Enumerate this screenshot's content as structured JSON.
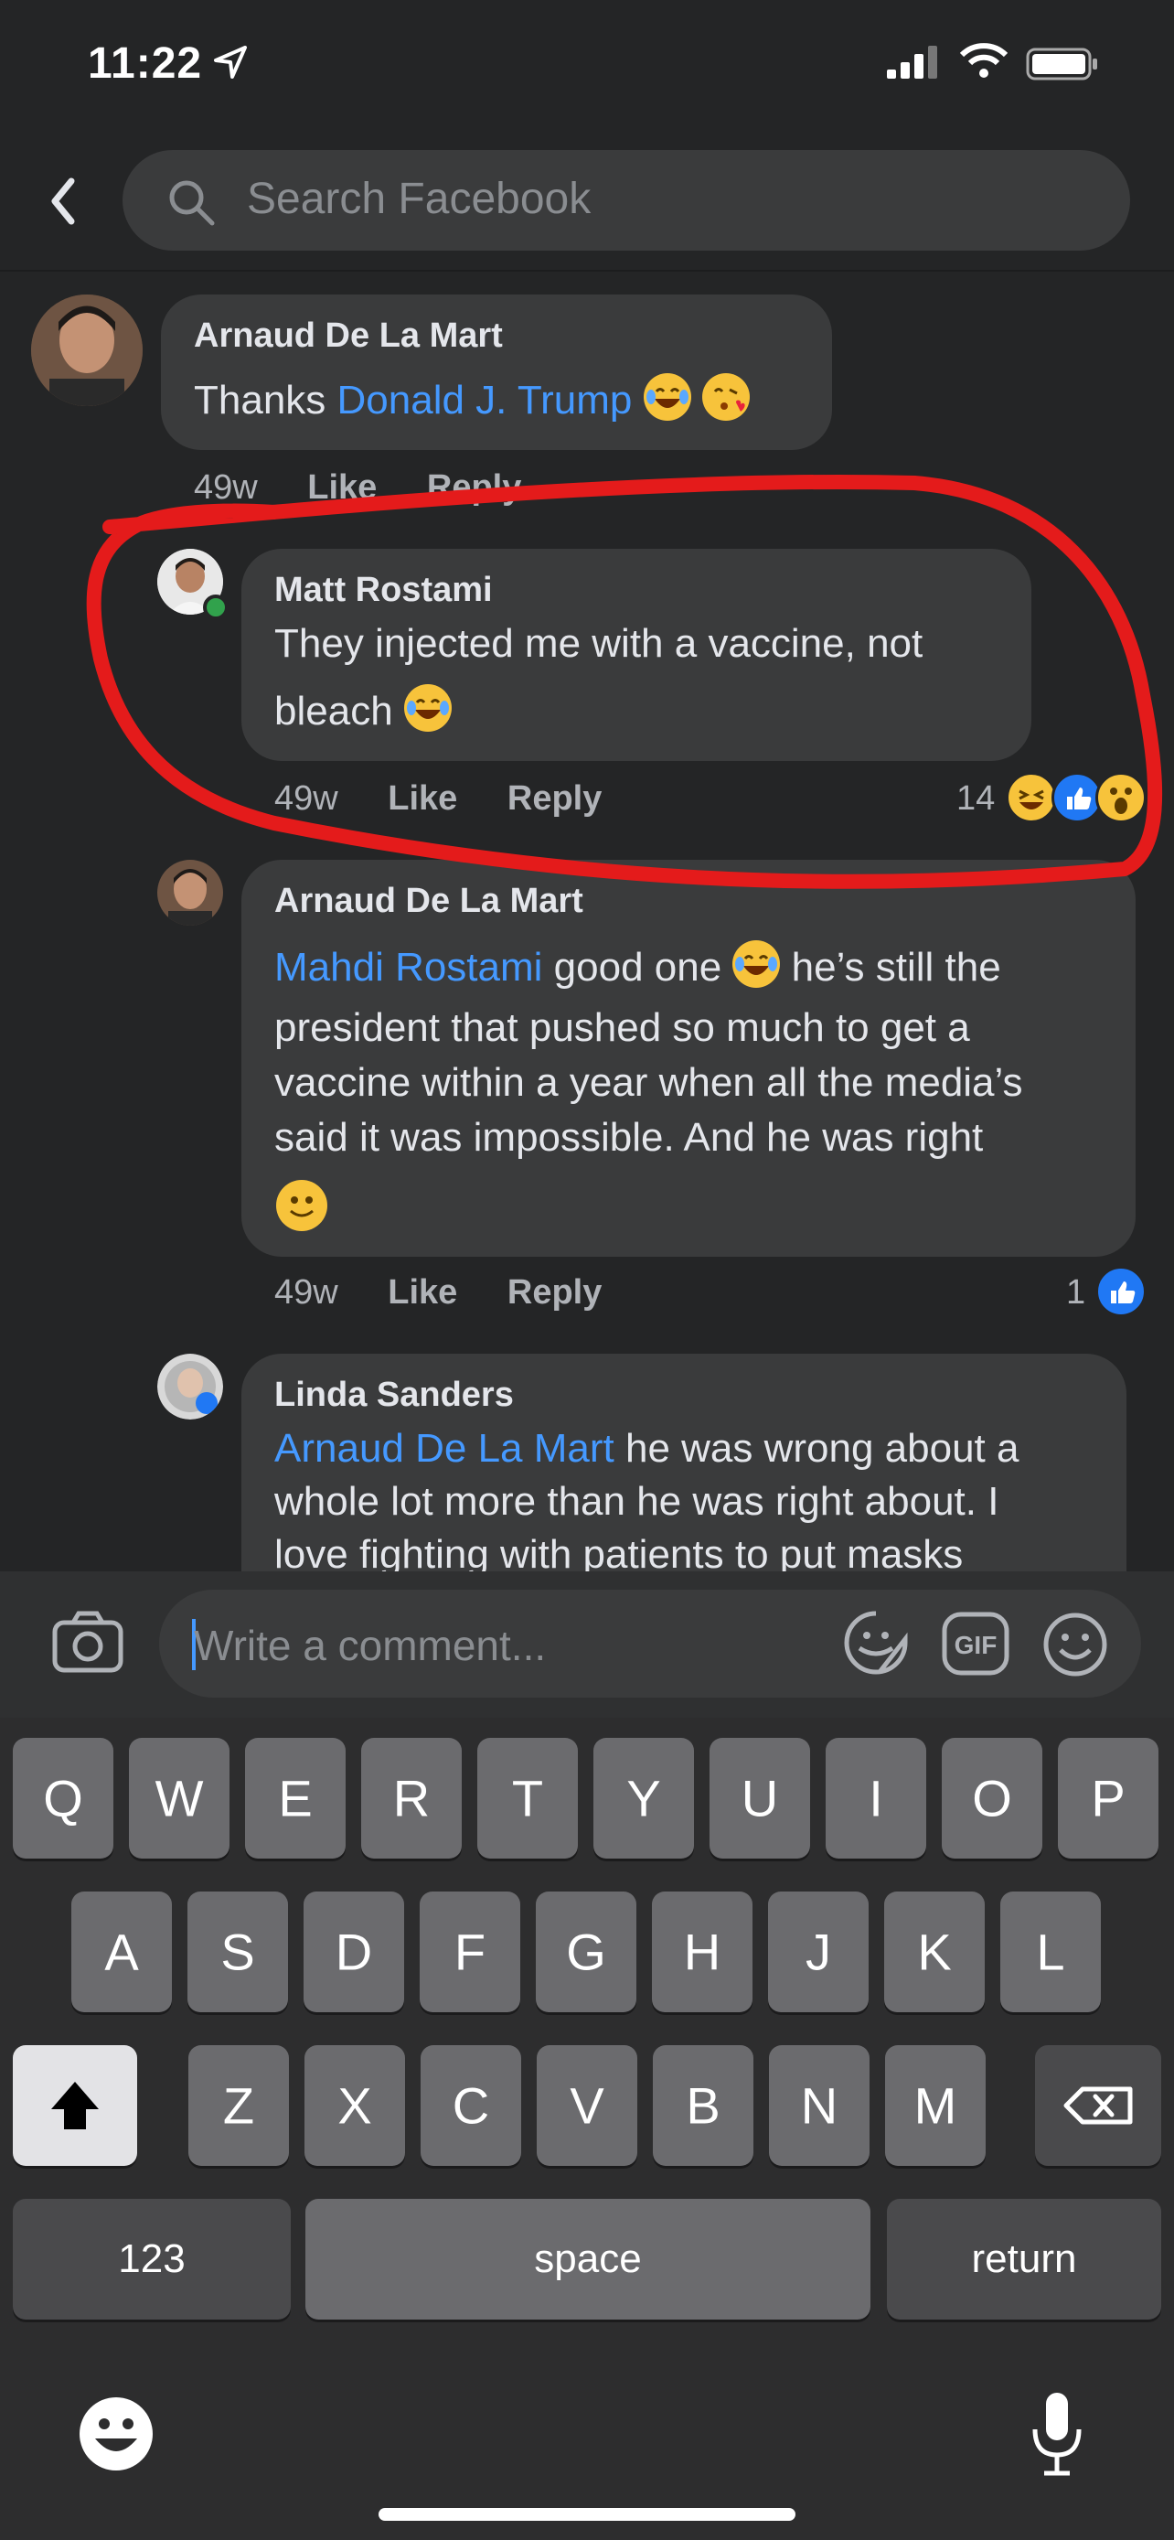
{
  "status_bar": {
    "time": "11:22"
  },
  "search": {
    "placeholder": "Search Facebook"
  },
  "comments": [
    {
      "author": "Arnaud De La Mart",
      "text_prefix": "Thanks ",
      "mention": "Donald J. Trump",
      "time": "49w",
      "like_label": "Like",
      "reply_label": "Reply"
    },
    {
      "author": "Matt Rostami",
      "text_line1": "They injected me with a vaccine, not",
      "text_line2": "bleach",
      "time": "49w",
      "like_label": "Like",
      "reply_label": "Reply",
      "reaction_count": "14",
      "reactions": [
        "laugh-icon",
        "like-icon",
        "wow-icon"
      ]
    },
    {
      "author": "Arnaud De La Mart",
      "mention": "Mahdi Rostami",
      "text_line1": " good one ",
      "text_line1_tail": " he’s still the",
      "text_line2": "president that pushed so much to get a",
      "text_line3": "vaccine within a year when all the media’s",
      "text_line4": "said it was impossible.  And he was right",
      "time": "49w",
      "like_label": "Like",
      "reply_label": "Reply",
      "reaction_count": "1",
      "reactions": [
        "like-icon"
      ]
    },
    {
      "author": "Linda Sanders",
      "mention": "Arnaud De La Mart",
      "text_line1": " he was wrong about a",
      "text_line2": "whole lot more than he was right about. I",
      "text_line3": "love fighting with patients to put masks"
    }
  ],
  "composer": {
    "placeholder": "Write a comment..."
  },
  "keyboard": {
    "row1": [
      "Q",
      "W",
      "E",
      "R",
      "T",
      "Y",
      "U",
      "I",
      "O",
      "P"
    ],
    "row2": [
      "A",
      "S",
      "D",
      "F",
      "G",
      "H",
      "J",
      "K",
      "L"
    ],
    "row3": [
      "Z",
      "X",
      "C",
      "V",
      "B",
      "N",
      "M"
    ],
    "numbers_label": "123",
    "space_label": "space",
    "return_label": "return"
  },
  "colors": {
    "accent": "#4599ff",
    "background": "#242526",
    "bubble": "#3a3b3c",
    "annotation": "#e41b1b"
  }
}
